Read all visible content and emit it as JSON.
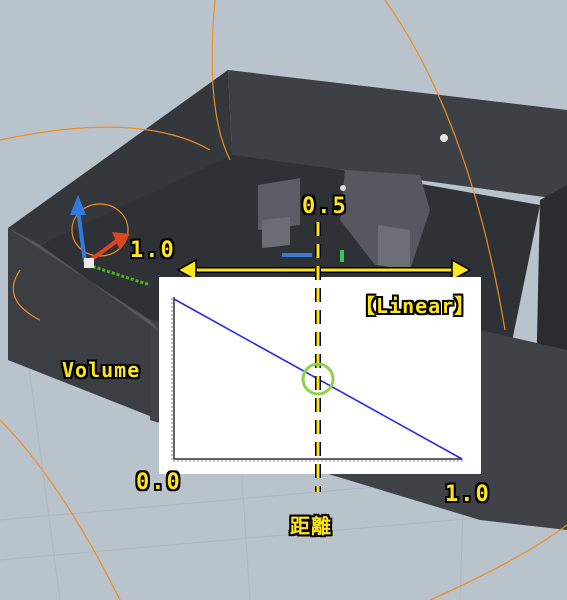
{
  "viewport": {
    "scene": "3d-editor-viewport",
    "colors": {
      "background": "#b9c3cc",
      "walls": "#3a3d42",
      "floor": "#2e3136",
      "attenuation_ring": "#f28c1e",
      "annotation": "#ffe61a",
      "curve": "#2a2ae6",
      "highlight_circle": "#8fd14f"
    }
  },
  "annotations": {
    "volume_max": "1.0",
    "volume_axis": "Volume",
    "distance_mid": "0.5",
    "curve_type": "【Linear】",
    "origin": "0.0",
    "distance_max": "1.0",
    "distance_axis": "距離"
  },
  "chart_data": {
    "type": "line",
    "x": [
      0.0,
      1.0
    ],
    "series": [
      {
        "values": [
          1.0,
          0.0
        ]
      }
    ],
    "xlim": [
      0.0,
      1.0
    ],
    "ylim": [
      0.0,
      1.0
    ],
    "grid": false,
    "highlight_x": 0.5
  }
}
